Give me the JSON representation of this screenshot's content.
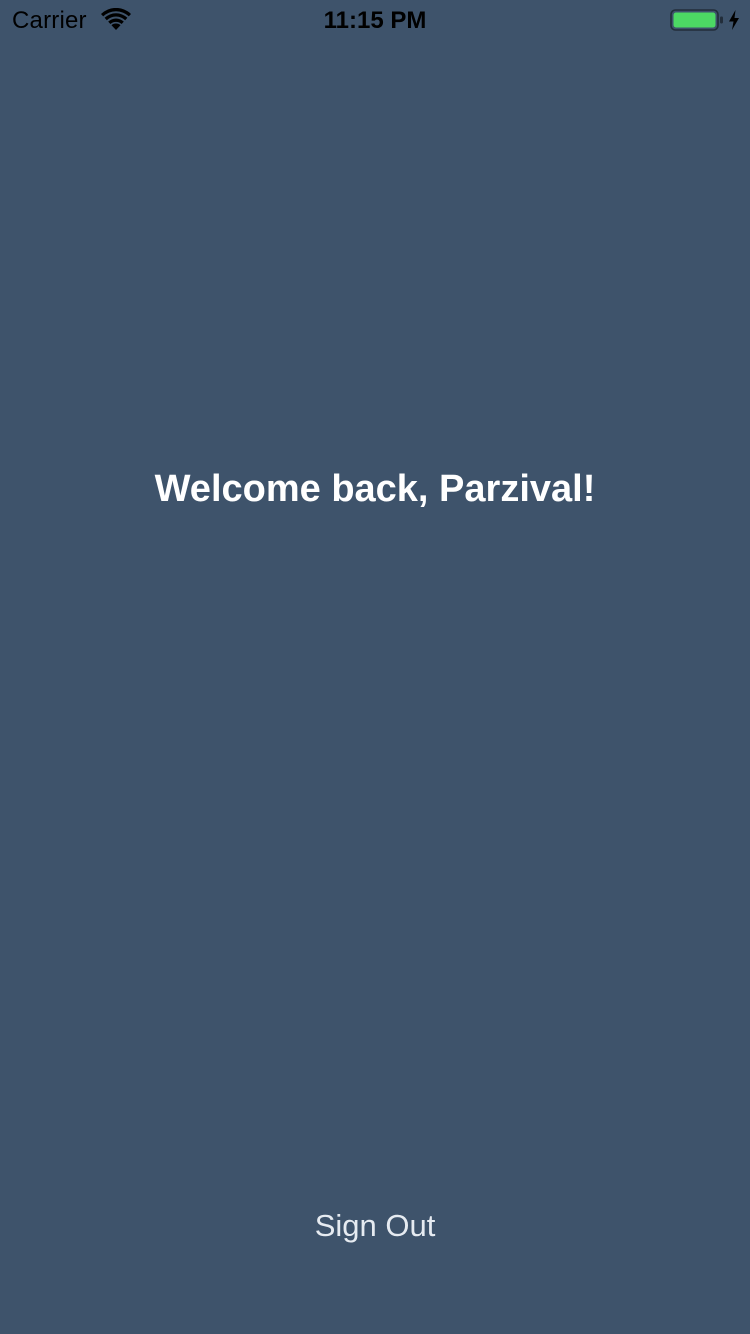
{
  "status_bar": {
    "carrier": "Carrier",
    "time": "11:15 PM",
    "wifi_icon": "wifi-icon",
    "battery_icon": "battery-icon",
    "charging_icon": "charging-bolt-icon",
    "battery_level": 1.0,
    "battery_color": "#4cd964"
  },
  "main": {
    "welcome_text": "Welcome back, Parzival!",
    "sign_out_label": "Sign Out"
  },
  "colors": {
    "background": "#3e536b",
    "text": "#ffffff"
  }
}
